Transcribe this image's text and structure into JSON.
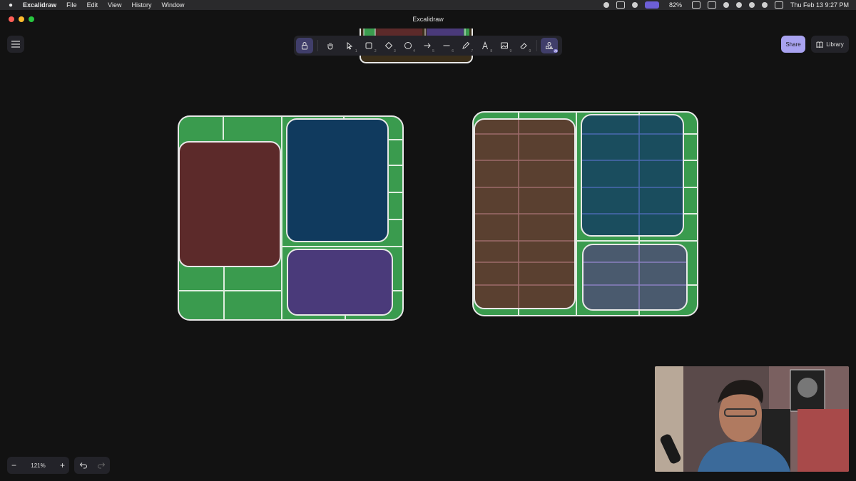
{
  "menubar": {
    "app_name": "Excalidraw",
    "menus": [
      "File",
      "Edit",
      "View",
      "History",
      "Window"
    ],
    "battery": "82%",
    "datetime": "Thu Feb 13  9:27 PM"
  },
  "window": {
    "title": "Excalidraw"
  },
  "toolbar": {
    "tools": [
      {
        "icon": "lock-icon",
        "num": ""
      },
      {
        "icon": "hand-icon",
        "num": ""
      },
      {
        "icon": "selection-icon",
        "num": "1"
      },
      {
        "icon": "rectangle-icon",
        "num": "2"
      },
      {
        "icon": "diamond-icon",
        "num": "3"
      },
      {
        "icon": "ellipse-icon",
        "num": "4"
      },
      {
        "icon": "arrow-icon",
        "num": "5"
      },
      {
        "icon": "line-icon",
        "num": "6"
      },
      {
        "icon": "pencil-icon",
        "num": "7"
      },
      {
        "icon": "text-icon",
        "num": "8"
      },
      {
        "icon": "image-icon",
        "num": "9"
      },
      {
        "icon": "eraser-icon",
        "num": "0"
      },
      {
        "icon": "ai-shapes-icon",
        "num": ""
      }
    ],
    "ai_badge": "AI"
  },
  "share_label": "Share",
  "library_label": "Library",
  "zoom": {
    "level": "121%"
  },
  "colors": {
    "canvas_bg": "#121212",
    "green": "#3a9b4e",
    "maroon": "#5c2a2a",
    "navy": "#103a5e",
    "purple": "#4a3a7a",
    "brown": "#5a4030",
    "teal": "#1a4d5e",
    "slate": "#4a5a6e",
    "accent": "#a8a2f0"
  }
}
